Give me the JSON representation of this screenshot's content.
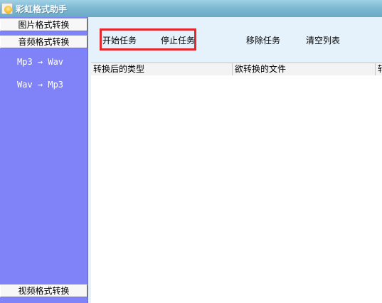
{
  "window": {
    "title": "彩虹格式助手",
    "icon": "rainbow-sun-icon"
  },
  "sidebar": {
    "image_format_label": "图片格式转换",
    "audio_format_label": "音频格式转换",
    "links": [
      {
        "label": "Mp3 → Wav"
      },
      {
        "label": "Wav → Mp3"
      }
    ],
    "video_format_label": "视频格式转换"
  },
  "toolbar": {
    "start_label": "开始任务",
    "stop_label": "停止任务",
    "remove_label": "移除任务",
    "clear_label": "清空列表",
    "highlight_color": "#e0282d"
  },
  "table": {
    "columns": [
      "转换后的类型",
      "欲转换的文件",
      "转"
    ],
    "rows": []
  },
  "colors": {
    "sidebar_bg": "#7f83f7",
    "toolbar_bg": "#e6f2fb",
    "titlebar_bg": "#7fb9d2"
  }
}
